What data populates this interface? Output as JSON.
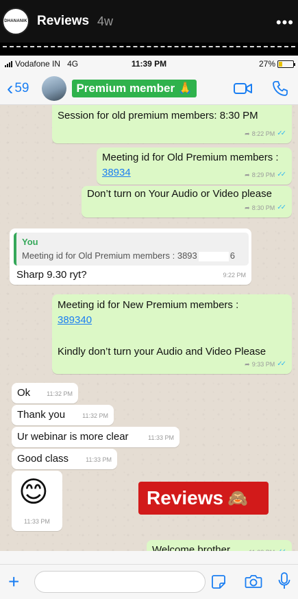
{
  "story": {
    "avatar_text": "DHANANIK",
    "title": "Reviews",
    "time": "4w",
    "more": "•••"
  },
  "statusbar": {
    "carrier": "Vodafone IN",
    "network": "4G",
    "time": "11:39 PM",
    "battery": "27%",
    "battery_level": 0.27
  },
  "chatbar": {
    "back_count": "59",
    "group_name": "Premium member 🙏"
  },
  "messages": [
    {
      "text": "Session for old premium members: 8:30 PM",
      "time": "8:22 PM"
    },
    {
      "text": "Meeting id for Old Premium members :",
      "link": "38934",
      "time": "8:29 PM"
    },
    {
      "text": "Don’t turn on Your Audio or Video please",
      "time": "8:30 PM"
    },
    {
      "quote_author": "You",
      "quote_text": "Meeting id for Old Premium members : 3893",
      "quote_end": "6",
      "text": "Sharp 9.30 ryt?",
      "time": "9:22 PM"
    },
    {
      "text": "Meeting id for New Premium members :",
      "link": "389340",
      "text2": "Kindly don’t turn your Audio and Video Please",
      "time": "9:33 PM"
    },
    {
      "text": "Ok",
      "time": "11:32 PM"
    },
    {
      "text": "Thank you",
      "time": "11:32 PM"
    },
    {
      "text": "Ur webinar is more clear",
      "time": "11:33 PM"
    },
    {
      "text": "Good class",
      "time": "11:33 PM"
    },
    {
      "emoji": "😊",
      "time": "11:33 PM"
    },
    {
      "text": "Welcome brother",
      "time": "11:38 PM"
    }
  ],
  "overlay": {
    "text": "Reviews",
    "emoji": "🙈"
  },
  "colors": {
    "outgoing": "#dcf8c6",
    "incoming": "#ffffff",
    "accent": "#1a7ef2",
    "group_badge": "#2fb24c",
    "overlay": "#d21a1a"
  }
}
